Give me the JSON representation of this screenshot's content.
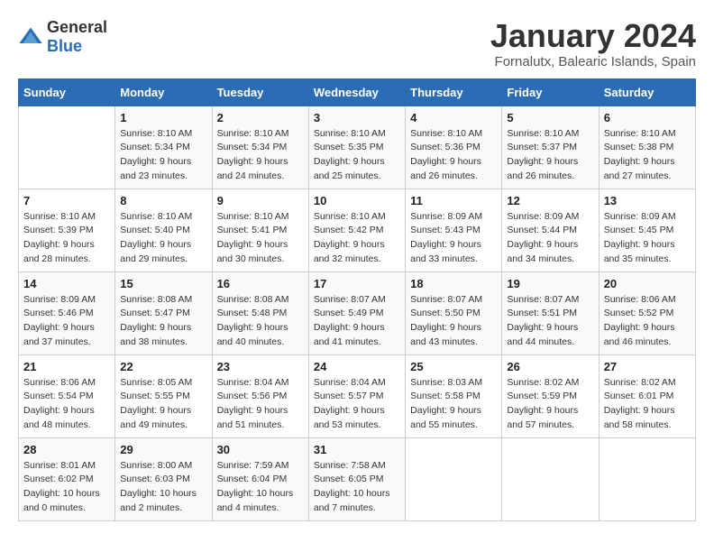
{
  "logo": {
    "text_general": "General",
    "text_blue": "Blue"
  },
  "title": "January 2024",
  "subtitle": "Fornalutx, Balearic Islands, Spain",
  "days_of_week": [
    "Sunday",
    "Monday",
    "Tuesday",
    "Wednesday",
    "Thursday",
    "Friday",
    "Saturday"
  ],
  "weeks": [
    [
      {
        "day": "",
        "info": ""
      },
      {
        "day": "1",
        "info": "Sunrise: 8:10 AM\nSunset: 5:34 PM\nDaylight: 9 hours\nand 23 minutes."
      },
      {
        "day": "2",
        "info": "Sunrise: 8:10 AM\nSunset: 5:34 PM\nDaylight: 9 hours\nand 24 minutes."
      },
      {
        "day": "3",
        "info": "Sunrise: 8:10 AM\nSunset: 5:35 PM\nDaylight: 9 hours\nand 25 minutes."
      },
      {
        "day": "4",
        "info": "Sunrise: 8:10 AM\nSunset: 5:36 PM\nDaylight: 9 hours\nand 26 minutes."
      },
      {
        "day": "5",
        "info": "Sunrise: 8:10 AM\nSunset: 5:37 PM\nDaylight: 9 hours\nand 26 minutes."
      },
      {
        "day": "6",
        "info": "Sunrise: 8:10 AM\nSunset: 5:38 PM\nDaylight: 9 hours\nand 27 minutes."
      }
    ],
    [
      {
        "day": "7",
        "info": "Sunrise: 8:10 AM\nSunset: 5:39 PM\nDaylight: 9 hours\nand 28 minutes."
      },
      {
        "day": "8",
        "info": "Sunrise: 8:10 AM\nSunset: 5:40 PM\nDaylight: 9 hours\nand 29 minutes."
      },
      {
        "day": "9",
        "info": "Sunrise: 8:10 AM\nSunset: 5:41 PM\nDaylight: 9 hours\nand 30 minutes."
      },
      {
        "day": "10",
        "info": "Sunrise: 8:10 AM\nSunset: 5:42 PM\nDaylight: 9 hours\nand 32 minutes."
      },
      {
        "day": "11",
        "info": "Sunrise: 8:09 AM\nSunset: 5:43 PM\nDaylight: 9 hours\nand 33 minutes."
      },
      {
        "day": "12",
        "info": "Sunrise: 8:09 AM\nSunset: 5:44 PM\nDaylight: 9 hours\nand 34 minutes."
      },
      {
        "day": "13",
        "info": "Sunrise: 8:09 AM\nSunset: 5:45 PM\nDaylight: 9 hours\nand 35 minutes."
      }
    ],
    [
      {
        "day": "14",
        "info": "Sunrise: 8:09 AM\nSunset: 5:46 PM\nDaylight: 9 hours\nand 37 minutes."
      },
      {
        "day": "15",
        "info": "Sunrise: 8:08 AM\nSunset: 5:47 PM\nDaylight: 9 hours\nand 38 minutes."
      },
      {
        "day": "16",
        "info": "Sunrise: 8:08 AM\nSunset: 5:48 PM\nDaylight: 9 hours\nand 40 minutes."
      },
      {
        "day": "17",
        "info": "Sunrise: 8:07 AM\nSunset: 5:49 PM\nDaylight: 9 hours\nand 41 minutes."
      },
      {
        "day": "18",
        "info": "Sunrise: 8:07 AM\nSunset: 5:50 PM\nDaylight: 9 hours\nand 43 minutes."
      },
      {
        "day": "19",
        "info": "Sunrise: 8:07 AM\nSunset: 5:51 PM\nDaylight: 9 hours\nand 44 minutes."
      },
      {
        "day": "20",
        "info": "Sunrise: 8:06 AM\nSunset: 5:52 PM\nDaylight: 9 hours\nand 46 minutes."
      }
    ],
    [
      {
        "day": "21",
        "info": "Sunrise: 8:06 AM\nSunset: 5:54 PM\nDaylight: 9 hours\nand 48 minutes."
      },
      {
        "day": "22",
        "info": "Sunrise: 8:05 AM\nSunset: 5:55 PM\nDaylight: 9 hours\nand 49 minutes."
      },
      {
        "day": "23",
        "info": "Sunrise: 8:04 AM\nSunset: 5:56 PM\nDaylight: 9 hours\nand 51 minutes."
      },
      {
        "day": "24",
        "info": "Sunrise: 8:04 AM\nSunset: 5:57 PM\nDaylight: 9 hours\nand 53 minutes."
      },
      {
        "day": "25",
        "info": "Sunrise: 8:03 AM\nSunset: 5:58 PM\nDaylight: 9 hours\nand 55 minutes."
      },
      {
        "day": "26",
        "info": "Sunrise: 8:02 AM\nSunset: 5:59 PM\nDaylight: 9 hours\nand 57 minutes."
      },
      {
        "day": "27",
        "info": "Sunrise: 8:02 AM\nSunset: 6:01 PM\nDaylight: 9 hours\nand 58 minutes."
      }
    ],
    [
      {
        "day": "28",
        "info": "Sunrise: 8:01 AM\nSunset: 6:02 PM\nDaylight: 10 hours\nand 0 minutes."
      },
      {
        "day": "29",
        "info": "Sunrise: 8:00 AM\nSunset: 6:03 PM\nDaylight: 10 hours\nand 2 minutes."
      },
      {
        "day": "30",
        "info": "Sunrise: 7:59 AM\nSunset: 6:04 PM\nDaylight: 10 hours\nand 4 minutes."
      },
      {
        "day": "31",
        "info": "Sunrise: 7:58 AM\nSunset: 6:05 PM\nDaylight: 10 hours\nand 7 minutes."
      },
      {
        "day": "",
        "info": ""
      },
      {
        "day": "",
        "info": ""
      },
      {
        "day": "",
        "info": ""
      }
    ]
  ]
}
